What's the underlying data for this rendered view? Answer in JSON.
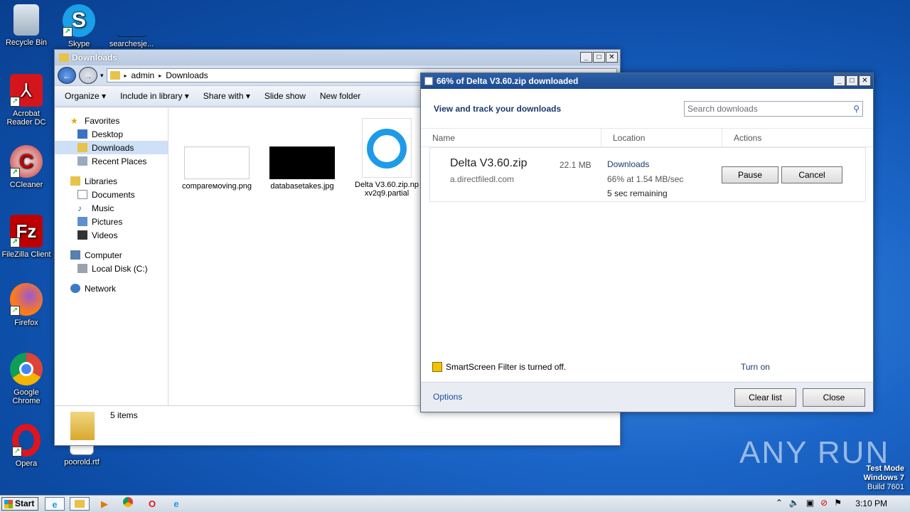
{
  "desktop": {
    "icons": [
      {
        "label": "Recycle Bin"
      },
      {
        "label": "Skype"
      },
      {
        "label": "searchesje..."
      },
      {
        "label": "Acrobat Reader DC"
      },
      {
        "label": "CCleaner"
      },
      {
        "label": "FileZilla Client"
      },
      {
        "label": "Firefox"
      },
      {
        "label": "Google Chrome"
      },
      {
        "label": "Opera"
      },
      {
        "label": "poorold.rtf"
      }
    ]
  },
  "explorer": {
    "title": "Downloads",
    "breadcrumb": [
      "admin",
      "Downloads"
    ],
    "toolbar": {
      "organize": "Organize",
      "include": "Include in library",
      "share": "Share with",
      "slideshow": "Slide show",
      "newfolder": "New folder"
    },
    "nav": {
      "favorites": "Favorites",
      "desktop": "Desktop",
      "downloads": "Downloads",
      "recent": "Recent Places",
      "libraries": "Libraries",
      "documents": "Documents",
      "music": "Music",
      "pictures": "Pictures",
      "videos": "Videos",
      "computer": "Computer",
      "localdisk": "Local Disk (C:)",
      "network": "Network"
    },
    "files": [
      {
        "name": "compareмoving.png"
      },
      {
        "name": "databasetakes.jpg"
      },
      {
        "name": "Delta V3.60.zip.npxv2q9.partial"
      }
    ],
    "status": "5 items"
  },
  "downloads_dialog": {
    "title": "66% of Delta V3.60.zip downloaded",
    "heading": "View and track your downloads",
    "search_placeholder": "Search downloads",
    "columns": {
      "name": "Name",
      "location": "Location",
      "actions": "Actions"
    },
    "item": {
      "filename": "Delta V3.60.zip",
      "size": "22.1 MB",
      "source": "a.directfiledl.com",
      "location": "Downloads",
      "progress": "66% at 1.54 MB/sec",
      "progress_fraction": 0.66,
      "remaining": "5 sec remaining",
      "pause": "Pause",
      "cancel": "Cancel"
    },
    "smartscreen": "SmartScreen Filter is turned off.",
    "turn_on": "Turn on",
    "options": "Options",
    "clear_list": "Clear list",
    "close": "Close"
  },
  "taskbar": {
    "start": "Start",
    "clock": "3:10 PM"
  },
  "watermark": {
    "line1": "Test Mode",
    "line2": "Windows 7",
    "line3": "Build 7601",
    "brand": "ANY RUN"
  },
  "colors": {
    "accent": "#1b3a6b",
    "titlebar_active": "#2b5fa8"
  }
}
